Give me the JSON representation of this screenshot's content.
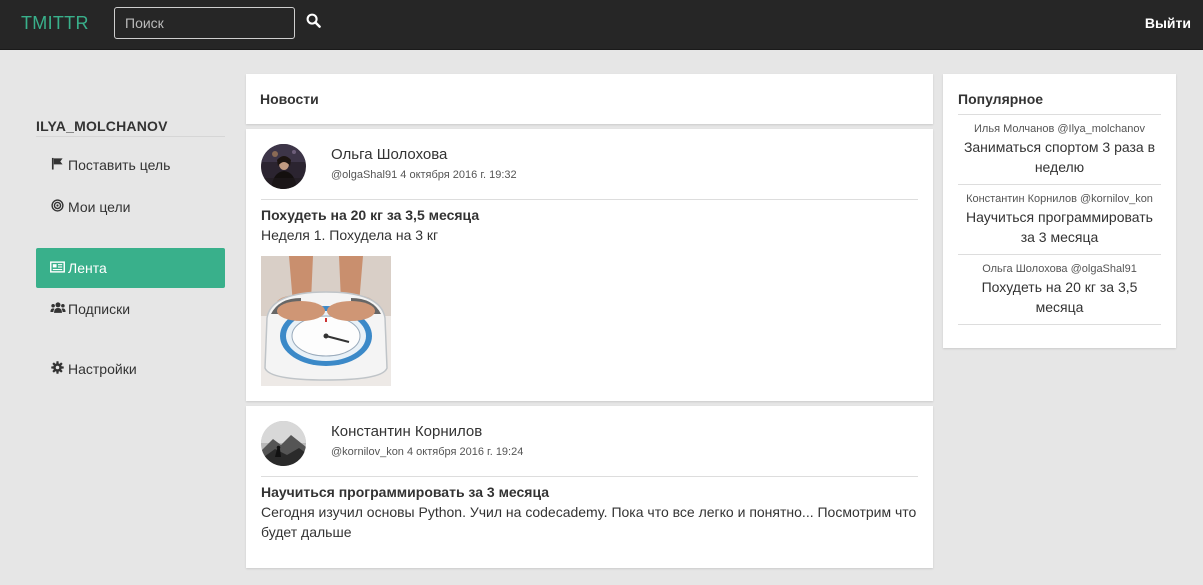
{
  "navbar": {
    "brand": "TMITTR",
    "search_placeholder": "Поиск",
    "search_icon": "search-icon",
    "logout_label": "Выйти"
  },
  "sidebar": {
    "username": "ILYA_MOLCHANOV",
    "items": [
      {
        "icon": "flag-icon",
        "label": "Поставить цель"
      },
      {
        "icon": "target-icon",
        "label": "Мои цели"
      },
      {
        "icon": "newspaper-icon",
        "label": "Лента",
        "active": true
      },
      {
        "icon": "users-icon",
        "label": "Подписки"
      },
      {
        "icon": "gear-icon",
        "label": "Настройки"
      }
    ]
  },
  "feed": {
    "title": "Новости",
    "posts": [
      {
        "author": "Ольга Шолохова",
        "meta": "@olgaShal91 4 октября 2016 г. 19:32",
        "title": "Похудеть на 20 кг за 3,5 месяца",
        "text": "Неделя 1. Похудела на 3 кг",
        "image": "scale-photo"
      },
      {
        "author": "Константин Корнилов",
        "meta": "@kornilov_kon 4 октября 2016 г. 19:24",
        "title": "Научиться программировать за 3 месяца",
        "text": "Сегодня изучил основы Python. Учил на codecademy. Пока что все легко и понятно... Посмотрим что будет дальше"
      }
    ]
  },
  "popular": {
    "title": "Популярное",
    "items": [
      {
        "user": "Илья Молчанов @Ilya_molchanov",
        "text": "Заниматься спортом 3 раза в неделю"
      },
      {
        "user": "Константин Корнилов @kornilov_kon",
        "text": "Научиться программировать за 3 месяца"
      },
      {
        "user": "Ольга Шолохова @olgaShal91",
        "text": "Похудеть на 20 кг за 3,5 месяца"
      }
    ]
  },
  "colors": {
    "accent": "#39b08b",
    "navbar": "#262626",
    "background": "#e6e6e6"
  }
}
